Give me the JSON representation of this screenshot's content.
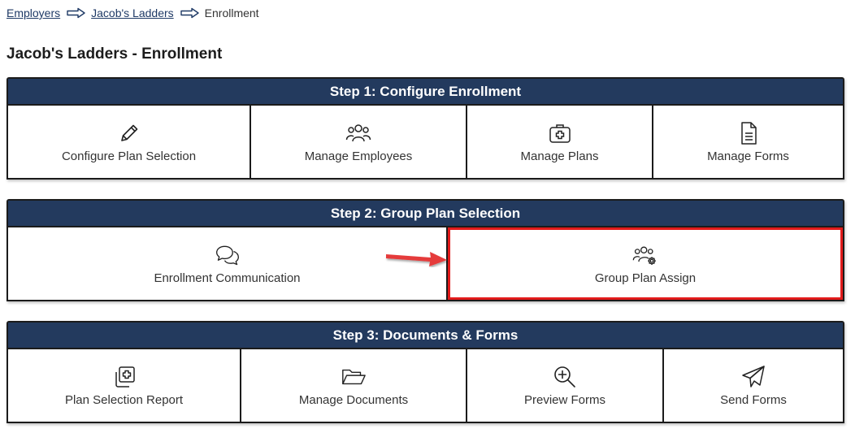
{
  "breadcrumb": {
    "items": [
      "Employers",
      "Jacob's Ladders"
    ],
    "current": "Enrollment"
  },
  "page_title": "Jacob's Ladders - Enrollment",
  "colors": {
    "header_bg": "#233a5e",
    "highlight": "#e21b1b",
    "link": "#1f3a66"
  },
  "step1": {
    "title": "Step 1: Configure Enrollment",
    "tiles": [
      {
        "label": "Configure Plan Selection",
        "icon": "pencil-icon"
      },
      {
        "label": "Manage Employees",
        "icon": "users-icon"
      },
      {
        "label": "Manage Plans",
        "icon": "medical-kit-icon"
      },
      {
        "label": "Manage Forms",
        "icon": "document-icon"
      }
    ]
  },
  "step2": {
    "title": "Step 2: Group Plan Selection",
    "tiles": [
      {
        "label": "Enrollment Communication",
        "icon": "chat-bubbles-icon"
      },
      {
        "label": "Group Plan Assign",
        "icon": "users-gear-icon"
      }
    ]
  },
  "step3": {
    "title": "Step 3: Documents & Forms",
    "tiles": [
      {
        "label": "Plan Selection Report",
        "icon": "add-copy-icon"
      },
      {
        "label": "Manage Documents",
        "icon": "folder-icon"
      },
      {
        "label": "Preview Forms",
        "icon": "zoom-in-icon"
      },
      {
        "label": "Send Forms",
        "icon": "paper-plane-icon"
      }
    ]
  }
}
